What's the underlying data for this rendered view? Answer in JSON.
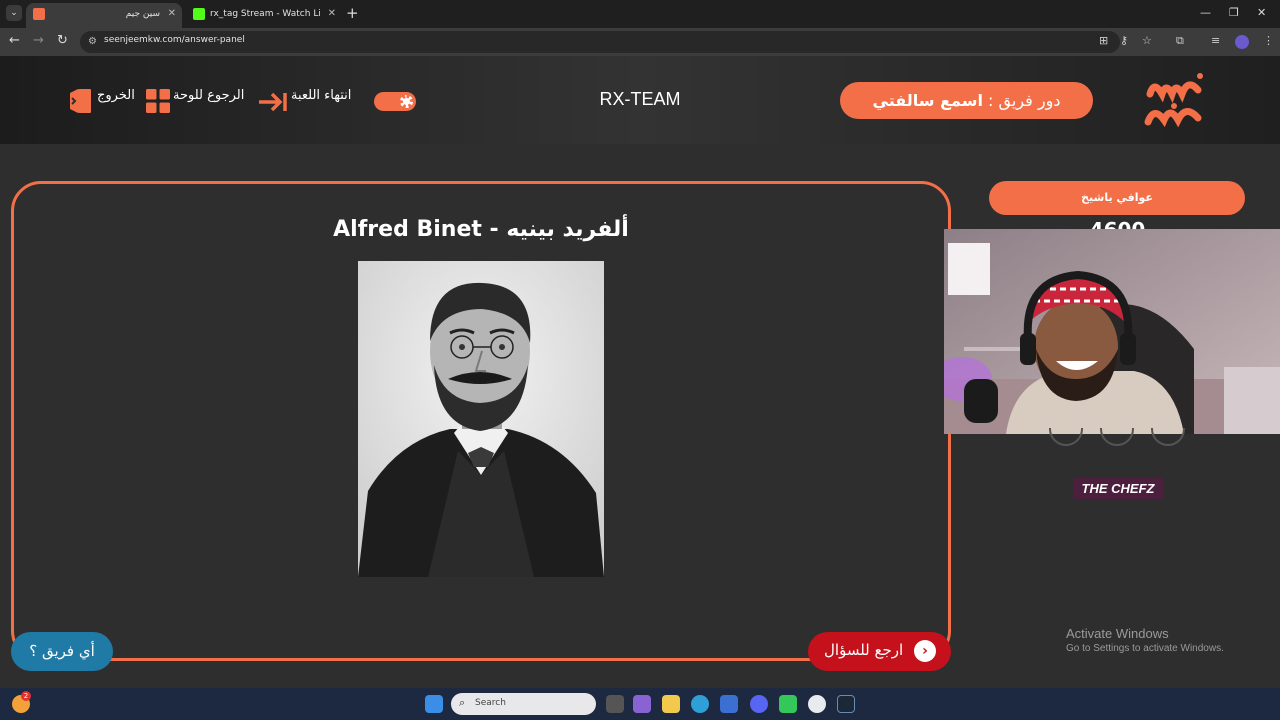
{
  "browser": {
    "tabs": [
      {
        "title": "سين جيم",
        "active": true
      },
      {
        "title": "rx_tag Stream - Watch Live on K",
        "active": false
      }
    ],
    "url": "seenjeemkw.com/answer-panel"
  },
  "header": {
    "logo_text": "سين جيم",
    "turn_prefix": "دور فريق :",
    "turn_team": "اسمع سالفتي",
    "team_name": "RX-TEAM",
    "end_game_label": "انتهاء اللعبة",
    "back_to_board_label": "الرجوع للوحة",
    "exit_label": "الخروج"
  },
  "question": {
    "answer_title": "Alfred Binet - ألفريد بينيه",
    "back_to_question_label": "ارجع للسؤال",
    "which_team_label": "أي فريق ؟"
  },
  "sidebar": {
    "team_label": "عوافي ياشيخ",
    "score": "4600",
    "sponsor": "THE CHEFZ"
  },
  "watermark": {
    "line1": "Activate Windows",
    "line2": "Go to Settings to activate Windows."
  },
  "taskbar": {
    "search_label": "Search",
    "weather_badge": "2"
  },
  "colors": {
    "accent": "#f36f47",
    "back_button": "#c4111b",
    "which_button": "#1f7aa6",
    "background": "#2e2e2e"
  }
}
